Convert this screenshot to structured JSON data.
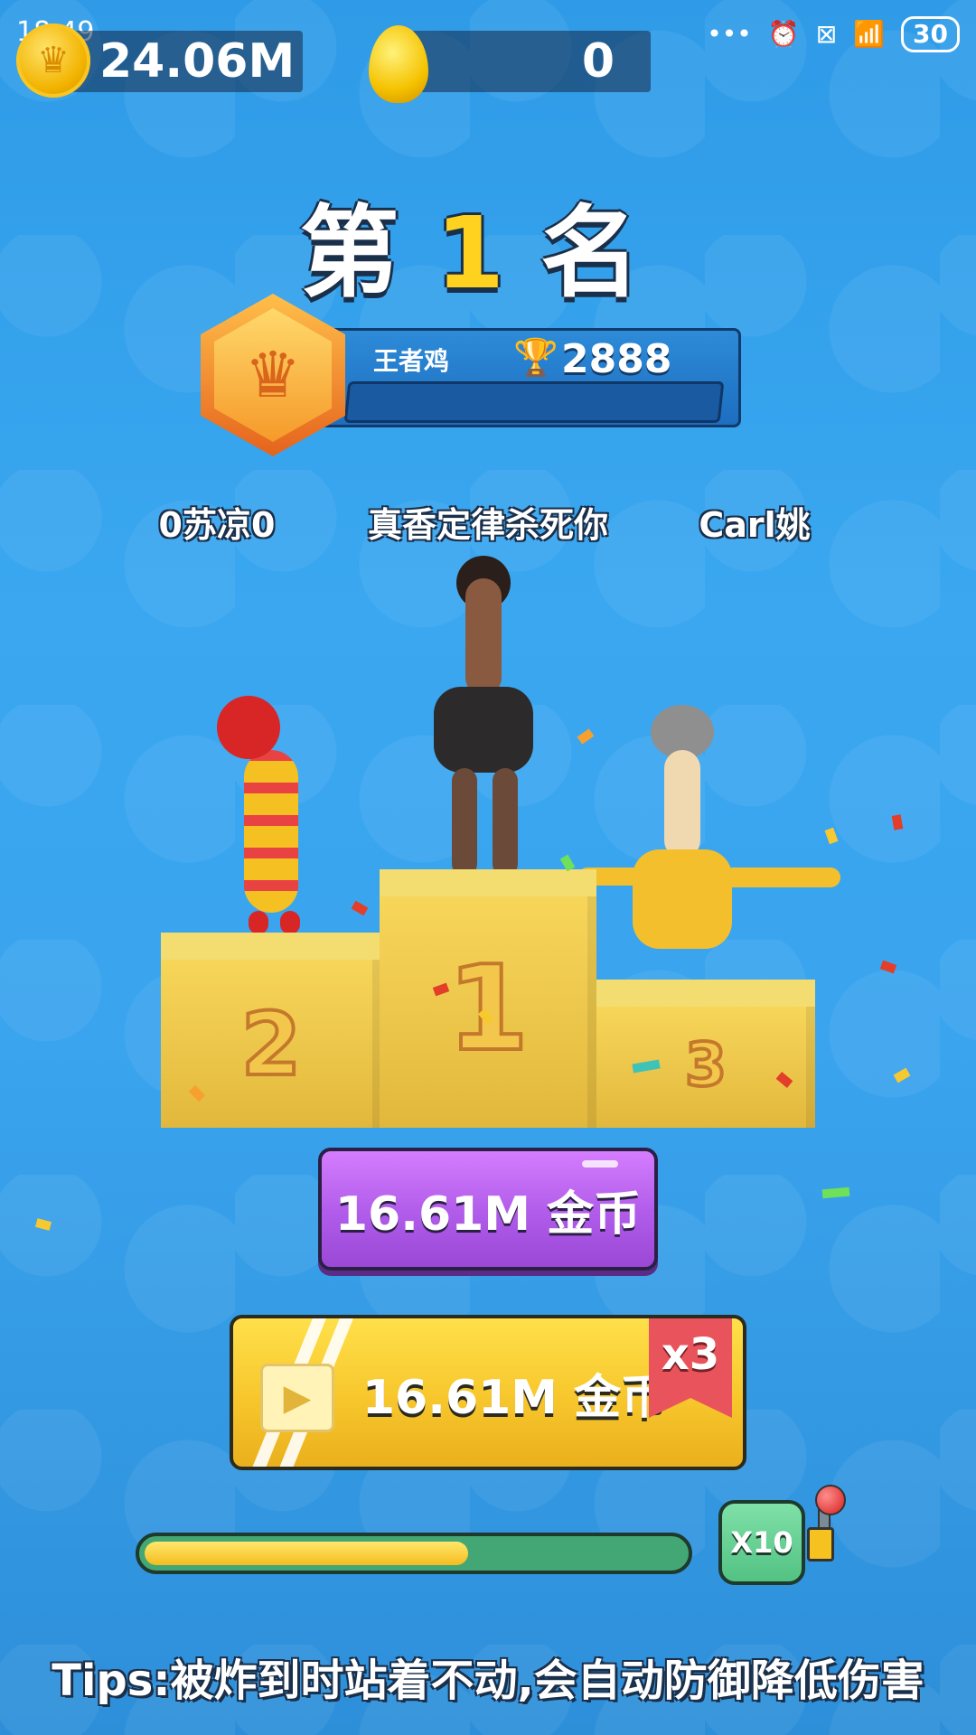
{
  "status_bar": {
    "time": "18:49",
    "icons": [
      "more-dots-icon",
      "alarm-icon",
      "sim-off-icon",
      "wifi-icon"
    ],
    "battery": "30"
  },
  "currency": {
    "coins": "24.06M",
    "eggs": "0"
  },
  "result": {
    "rank_prefix": "第",
    "rank_number": "1",
    "rank_suffix": "名"
  },
  "player": {
    "name": "王者鸡",
    "trophies": "2888"
  },
  "podium": {
    "second_name": "0苏凉0",
    "first_name": "真香定律杀死你",
    "third_name": "Carl姚",
    "digits": [
      "2",
      "1",
      "3"
    ]
  },
  "rewards": {
    "claim_label": "16.61M  金币",
    "video_label": "16.61M  金币",
    "multiplier_badge": "x3"
  },
  "multiplier": {
    "button_label": "X10",
    "progress_fraction": 0.6
  },
  "tips": "Tips:被炸到时站着不动,会自动防御降低伤害",
  "colors": {
    "background": "#3aa7f0",
    "gold": "#f7d65a",
    "purple_button": "#b05be9",
    "yellow_button": "#f7c62c",
    "green_progress": "#43a775"
  }
}
